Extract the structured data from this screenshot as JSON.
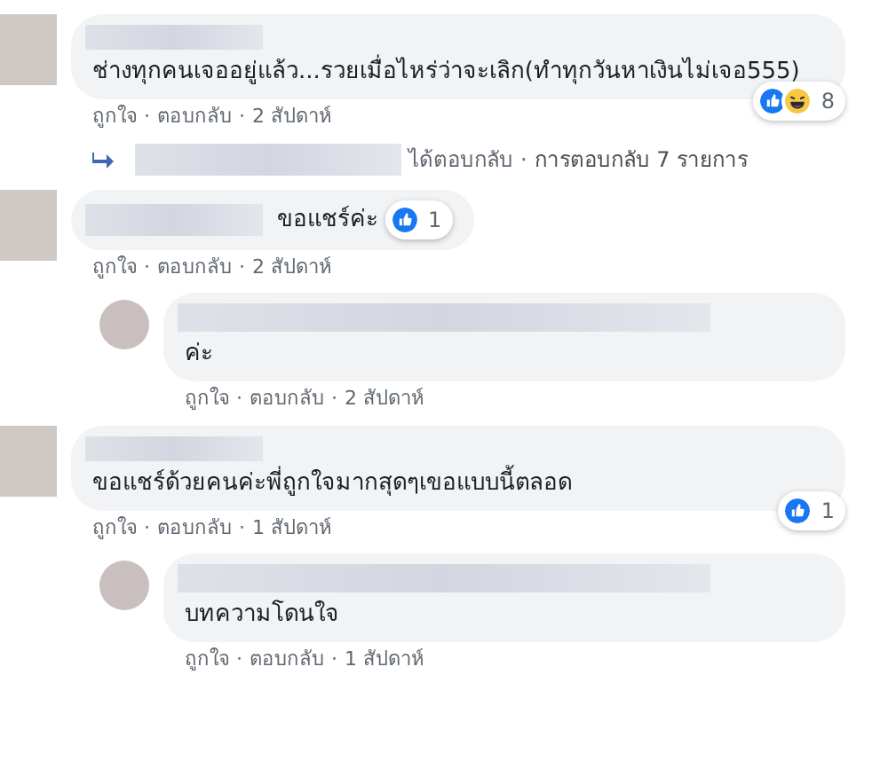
{
  "separator": "·",
  "comments": [
    {
      "kind": "comment",
      "text": "ช่างทุกคนเจออยู่แล้ว...รวยเมื่อไหร่ว่าจะเลิก(ทำทุกวันหาเงินไม่เจอ555)",
      "reactions": {
        "icons": [
          {
            "kind": "like"
          },
          {
            "kind": "haha"
          }
        ],
        "count": "8",
        "inline": false
      },
      "actions": [
        "ถูกใจ",
        "ตอบกลับ",
        "2 สัปดาห์"
      ],
      "replies_summary": [
        "ได้ตอบกลับ",
        "การตอบกลับ 7 รายการ"
      ]
    },
    {
      "kind": "comment",
      "text": "ขอแชร์ค่ะ",
      "reactions": {
        "icons": [
          {
            "kind": "like"
          }
        ],
        "count": "1",
        "inline": true
      },
      "actions": [
        "ถูกใจ",
        "ตอบกลับ",
        "2 สัปดาห์"
      ]
    },
    {
      "kind": "reply",
      "text": "ค่ะ",
      "actions": [
        "ถูกใจ",
        "ตอบกลับ",
        "2 สัปดาห์"
      ]
    },
    {
      "kind": "comment",
      "text": "ขอแชร์ด้วยคนค่ะพี่ถูกใจมากสุดๆเขอแบบนี้ตลอด",
      "reactions": {
        "icons": [
          {
            "kind": "like"
          }
        ],
        "count": "1",
        "inline": false
      },
      "actions": [
        "ถูกใจ",
        "ตอบกลับ",
        "1 สัปดาห์"
      ]
    },
    {
      "kind": "reply",
      "text": "บทความโดนใจ",
      "actions": [
        "ถูกใจ",
        "ตอบกลับ",
        "1 สัปดาห์"
      ]
    }
  ]
}
